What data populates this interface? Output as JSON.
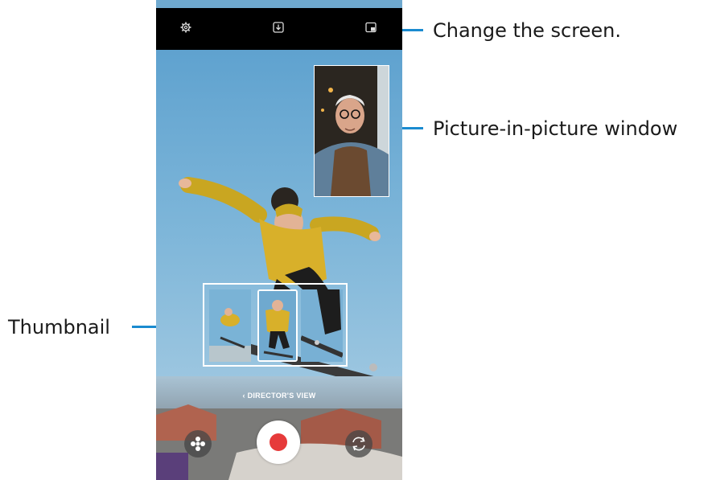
{
  "camera": {
    "directors_view_label": "DIRECTOR'S VIEW",
    "top_icons": [
      "gear-icon",
      "download-icon",
      "screen-layout-icon"
    ],
    "bottom_icons": [
      "effects-icon",
      "record-button",
      "switch-camera-icon"
    ]
  },
  "callouts": {
    "change_screen": "Change the screen.",
    "pip_window": "Picture-in-picture window",
    "thumbnail": "Thumbnail"
  },
  "colors": {
    "callout_line": "#1a8bd0",
    "record": "#e63a3a",
    "sky": "#6fa9cf"
  }
}
